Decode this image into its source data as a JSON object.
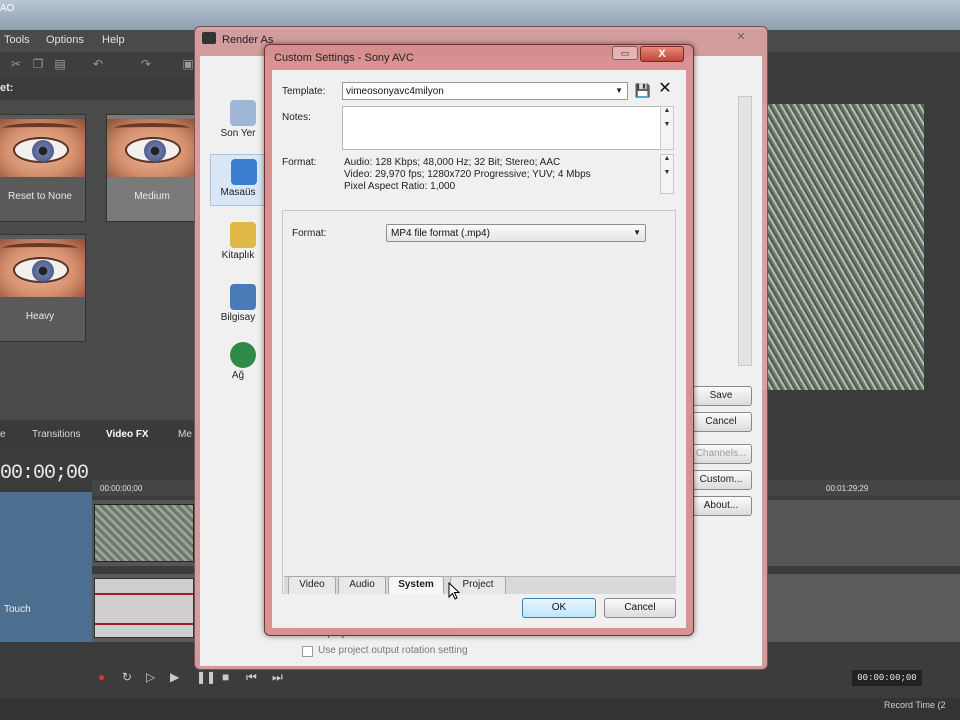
{
  "editor": {
    "title": "AO",
    "menu": [
      "Tools",
      "Options",
      "Help"
    ],
    "preset_label": "et:",
    "presets": [
      {
        "label": "Reset to None",
        "selected": false
      },
      {
        "label": "Medium",
        "selected": true
      },
      {
        "label": "Heavy",
        "selected": false
      }
    ],
    "bottom_tabs": [
      "e",
      "Transitions",
      "Video FX",
      "Me"
    ],
    "timecode": "00:00;00",
    "ruler_left": "00:00:00;00",
    "ruler_right": "00:01:29;29",
    "track_label": "Touch",
    "transport_tc": "00:00:00;00",
    "record_time": "Record Time (2"
  },
  "render_as": {
    "title": "Render As",
    "close_glyph": "✕",
    "nav": [
      {
        "label": "Son Yer",
        "icon": "recent-places-icon",
        "color": "#9fb6d6"
      },
      {
        "label": "Masaüs",
        "icon": "desktop-icon",
        "color": "#3b7fd0",
        "selected": true
      },
      {
        "label": "Kitaplık",
        "icon": "libraries-icon",
        "color": "#e0b84a"
      },
      {
        "label": "Bilgisay",
        "icon": "computer-icon",
        "color": "#4a7ab8"
      },
      {
        "label": "Ağ",
        "icon": "network-icon",
        "color": "#2f8a4a"
      }
    ],
    "buttons": {
      "save": "Save",
      "cancel": "Cancel",
      "channels": "Channels...",
      "custom": "Custom...",
      "about": "About..."
    },
    "checkbox1": "Save project markers in media file",
    "checkbox2": "Use project output rotation setting"
  },
  "custom_settings": {
    "title": "Custom Settings - Sony AVC",
    "template_label": "Template:",
    "template_value": "vimeosonyavc4milyon",
    "notes_label": "Notes:",
    "notes_value": "",
    "format_label": "Format:",
    "format_lines": [
      "Audio: 128 Kbps; 48,000 Hz; 32 Bit; Stereo; AAC",
      "Video: 29,970 fps; 1280x720 Progressive; YUV; 4 Mbps",
      "Pixel Aspect Ratio: 1,000"
    ],
    "panel_format_label": "Format:",
    "panel_format_value": "MP4 file format (.mp4)",
    "tabs": [
      {
        "label": "Video",
        "active": false
      },
      {
        "label": "Audio",
        "active": false
      },
      {
        "label": "System",
        "active": true
      },
      {
        "label": "Project",
        "active": false
      }
    ],
    "ok": "OK",
    "cancel": "Cancel",
    "close_glyph": "X",
    "min_glyph": "▭"
  }
}
